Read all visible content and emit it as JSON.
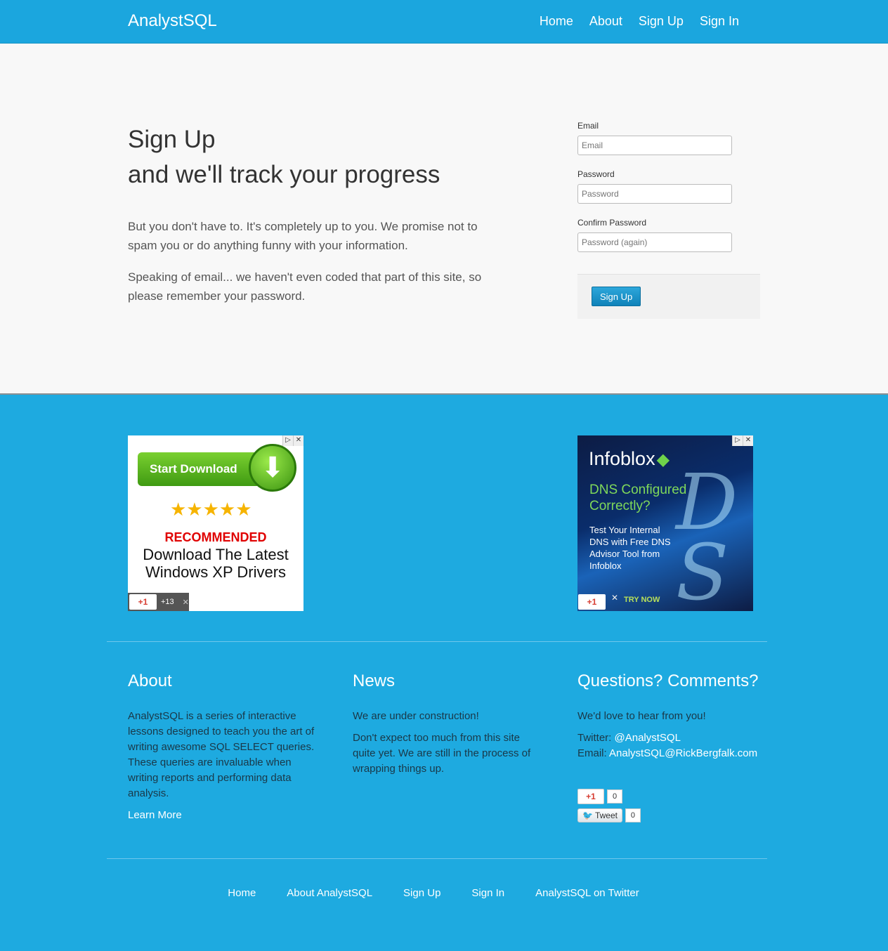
{
  "header": {
    "brand": "AnalystSQL",
    "nav": [
      "Home",
      "About",
      "Sign Up",
      "Sign In"
    ]
  },
  "hero": {
    "title_line1": "Sign Up",
    "title_line2": "and we'll track your progress",
    "paragraph1": "But you don't have to. It's completely up to you. We promise not to spam you or do anything funny with your information.",
    "paragraph2": "Speaking of email... we haven't even coded that part of this site, so please remember your password."
  },
  "form": {
    "email_label": "Email",
    "email_placeholder": "Email",
    "password_label": "Password",
    "password_placeholder": "Password",
    "confirm_label": "Confirm Password",
    "confirm_placeholder": "Password (again)",
    "submit_label": "Sign Up"
  },
  "ads": {
    "left": {
      "button_text": "Start Download",
      "stars": "★★★★★",
      "recommended": "RECOMMENDED",
      "headline": "Download The Latest Windows XP Drivers",
      "gplus": "+1",
      "gplus_count": "+13"
    },
    "right": {
      "logo": "Infoblox",
      "headline": "DNS Configured Correctly?",
      "sub": "Test Your Internal DNS with Free DNS Advisor Tool from Infoblox",
      "cta": "TRY NOW",
      "gplus": "+1"
    }
  },
  "footer": {
    "about": {
      "title": "About",
      "text": "AnalystSQL is a series of interactive lessons designed to teach you the art of writing awesome SQL SELECT queries. These queries are invaluable when writing reports and performing data analysis.",
      "link": "Learn More"
    },
    "news": {
      "title": "News",
      "p1": "We are under construction!",
      "p2": "Don't expect too much from this site quite yet. We are still in the process of wrapping things up."
    },
    "questions": {
      "title": "Questions? Comments?",
      "p1": "We'd love to hear from you!",
      "twitter_label": "Twitter: ",
      "twitter_handle": "@AnalystSQL",
      "email_label": "Email: ",
      "email_address": "AnalystSQL@RickBergfalk.com"
    },
    "social": {
      "gplus_label": "+1",
      "gplus_count": "0",
      "tweet_label": "Tweet",
      "tweet_count": "0"
    },
    "bottom_nav": [
      "Home",
      "About AnalystSQL",
      "Sign Up",
      "Sign In",
      "AnalystSQL on Twitter"
    ]
  },
  "colors": {
    "brand_blue": "#1ba6de",
    "hero_bg": "#f8f8f8",
    "button_blue": "#1a93cc"
  }
}
